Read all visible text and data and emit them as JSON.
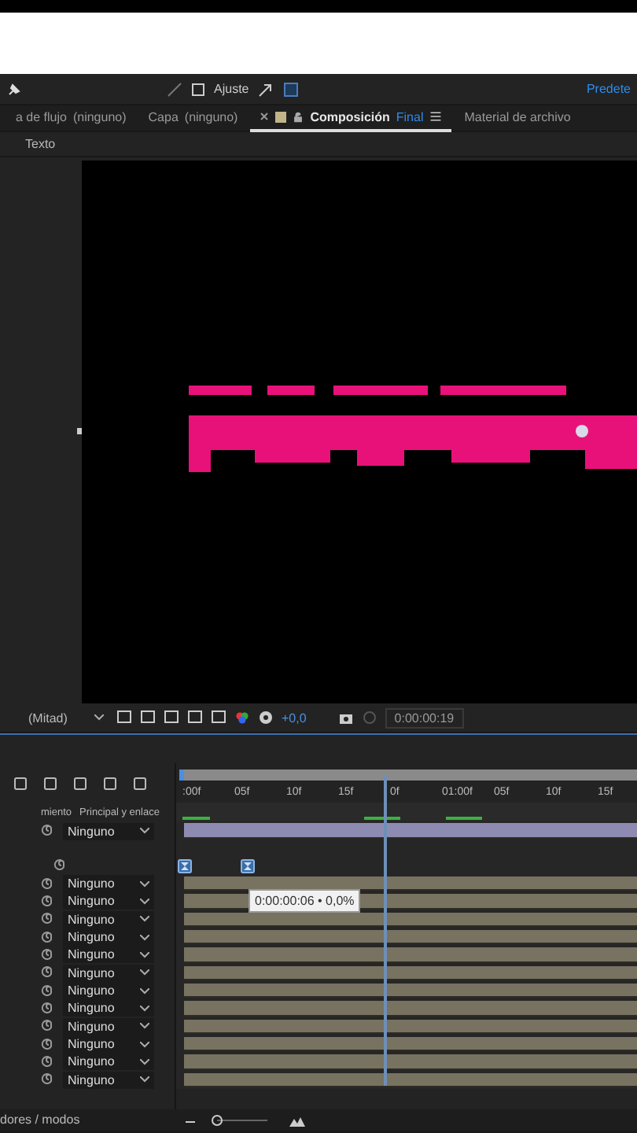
{
  "toolbar": {
    "snap": {
      "label": "Ajuste",
      "checked": false
    },
    "workspace": "Predete"
  },
  "panel_tabs": [
    {
      "label": "a de flujo",
      "detail": "(ninguno)",
      "selected": false
    },
    {
      "label": "Capa",
      "detail": "(ninguno)",
      "selected": false
    },
    {
      "label": "Composición",
      "detail": "Final",
      "selected": true
    },
    {
      "label": "Material de archivo",
      "selected": false
    }
  ],
  "sub_tab": "Texto",
  "viewer_toolbar": {
    "resolution": "(Mitad)",
    "exposure": "+0,0",
    "timecode": "0:00:00:19"
  },
  "timeline": {
    "ruler": [
      ":00f",
      "05f",
      "10f",
      "15f",
      "0f",
      "01:00f",
      "05f",
      "10f",
      "15f"
    ],
    "playhead": {
      "level": 0.45
    },
    "columns": [
      "miento",
      "Principal y enlace"
    ],
    "layers": [
      {
        "kind": "text",
        "parent": "Ninguno"
      },
      {
        "kind": "keyframes"
      },
      {
        "kind": "layer",
        "parent": "Ninguno"
      },
      {
        "kind": "layer",
        "parent": "Ninguno"
      },
      {
        "kind": "layer",
        "parent": "Ninguno"
      },
      {
        "kind": "layer",
        "parent": "Ninguno"
      },
      {
        "kind": "layer",
        "parent": "Ninguno"
      },
      {
        "kind": "layer",
        "parent": "Ninguno"
      },
      {
        "kind": "layer",
        "parent": "Ninguno"
      },
      {
        "kind": "layer",
        "parent": "Ninguno"
      },
      {
        "kind": "layer",
        "parent": "Ninguno"
      },
      {
        "kind": "layer",
        "parent": "Ninguno"
      },
      {
        "kind": "layer",
        "parent": "Ninguno"
      },
      {
        "kind": "layer",
        "parent": "Ninguno"
      }
    ],
    "tooltip": "0:00:00:06 • 0,0%"
  },
  "status": "dores / modos",
  "zoom": {
    "level": 0
  }
}
